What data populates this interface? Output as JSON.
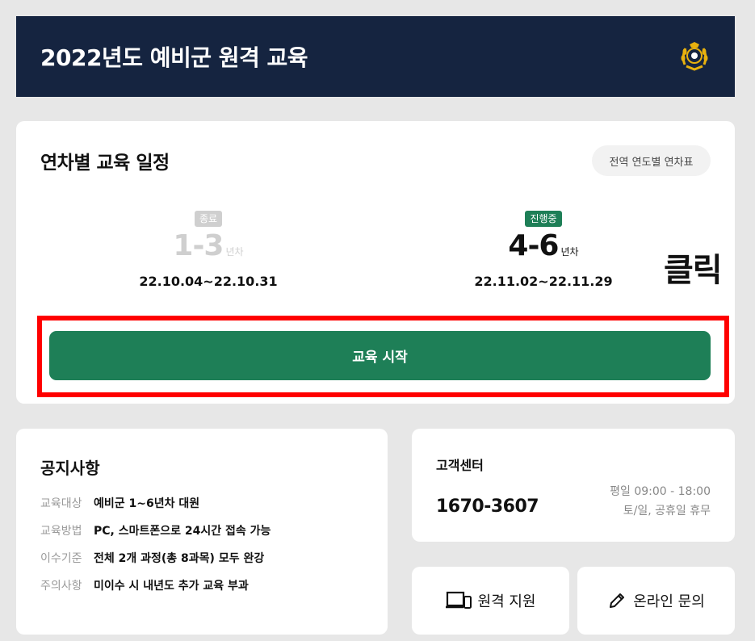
{
  "header": {
    "title": "2022년도 예비군 원격 교육",
    "emblem_icon": "laurel-emblem-icon"
  },
  "schedule": {
    "title": "연차별 교육 일정",
    "table_link": "전역 연도별 연차표",
    "rounds": [
      {
        "status": "종료",
        "range": "1-3",
        "unit": "년차",
        "dates": "22.10.04~22.10.31"
      },
      {
        "status": "진행중",
        "range": "4-6",
        "unit": "년차",
        "dates": "22.11.02~22.11.29"
      }
    ],
    "start_button": "교육 시작",
    "annotation": "클릭"
  },
  "notice": {
    "title": "공지사항",
    "rows": [
      {
        "key": "교육대상",
        "value": "예비군 1~6년차 대원"
      },
      {
        "key": "교육방법",
        "value": "PC, 스마트폰으로 24시간 접속 가능"
      },
      {
        "key": "이수기준",
        "value": "전체 2개 과정(총 8과목) 모두 완강"
      },
      {
        "key": "주의사항",
        "value": "미이수 시 내년도 추가 교육 부과"
      }
    ]
  },
  "customer_center": {
    "title": "고객센터",
    "phone": "1670-3607",
    "hours_weekday": "평일 09:00 - 18:00",
    "hours_weekend": "토/일, 공휴일 휴무"
  },
  "actions": {
    "remote_support": "원격 지원",
    "online_inquiry": "온라인 문의"
  },
  "colors": {
    "header_bg": "#152440",
    "accent_green": "#1e7f57",
    "highlight_red": "#ff0000",
    "emblem_gold": "#e8b10e"
  }
}
